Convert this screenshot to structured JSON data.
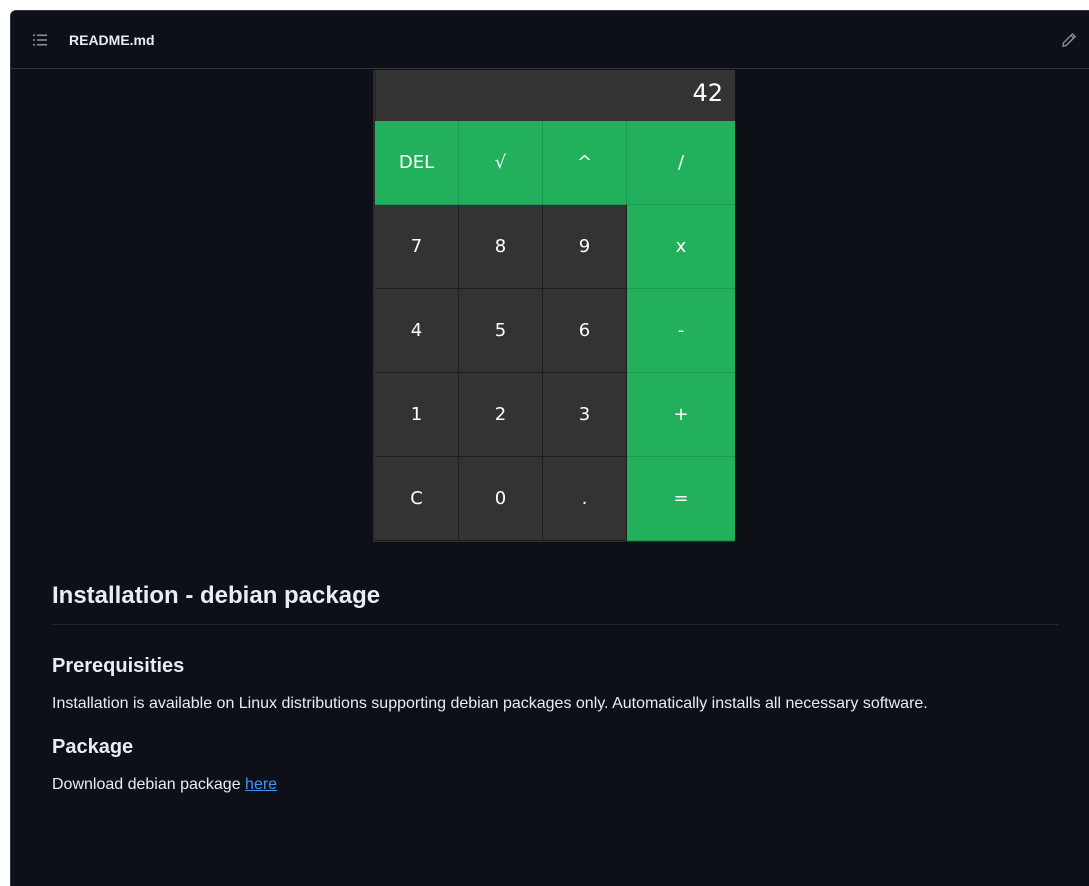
{
  "header": {
    "file_name": "README.md",
    "toc_icon": "list-icon",
    "edit_icon": "pencil-icon"
  },
  "calculator": {
    "display_value": "42",
    "keys": [
      {
        "label": "DEL",
        "type": "op"
      },
      {
        "label": "√",
        "type": "op"
      },
      {
        "label": "^",
        "type": "op"
      },
      {
        "label": "/",
        "type": "op"
      },
      {
        "label": "7",
        "type": "num"
      },
      {
        "label": "8",
        "type": "num"
      },
      {
        "label": "9",
        "type": "num"
      },
      {
        "label": "x",
        "type": "op"
      },
      {
        "label": "4",
        "type": "num"
      },
      {
        "label": "5",
        "type": "num"
      },
      {
        "label": "6",
        "type": "num"
      },
      {
        "label": "-",
        "type": "op"
      },
      {
        "label": "1",
        "type": "num"
      },
      {
        "label": "2",
        "type": "num"
      },
      {
        "label": "3",
        "type": "num"
      },
      {
        "label": "+",
        "type": "op"
      },
      {
        "label": "C",
        "type": "num"
      },
      {
        "label": "0",
        "type": "num"
      },
      {
        "label": ".",
        "type": "num"
      },
      {
        "label": "=",
        "type": "op"
      }
    ],
    "colors": {
      "green": "#22b05d",
      "dark": "#333333"
    }
  },
  "readme": {
    "h2": "Installation - debian package",
    "prereq_heading": "Prerequisities",
    "prereq_text": "Installation is available on Linux distributions supporting debian packages only. Automatically installs all necessary software.",
    "package_heading": "Package",
    "package_text": "Download debian package",
    "package_link": "here"
  },
  "theme": {
    "background": "#0d1117",
    "border": "#30363d",
    "text": "#e6edf3",
    "link": "#4493f8"
  }
}
